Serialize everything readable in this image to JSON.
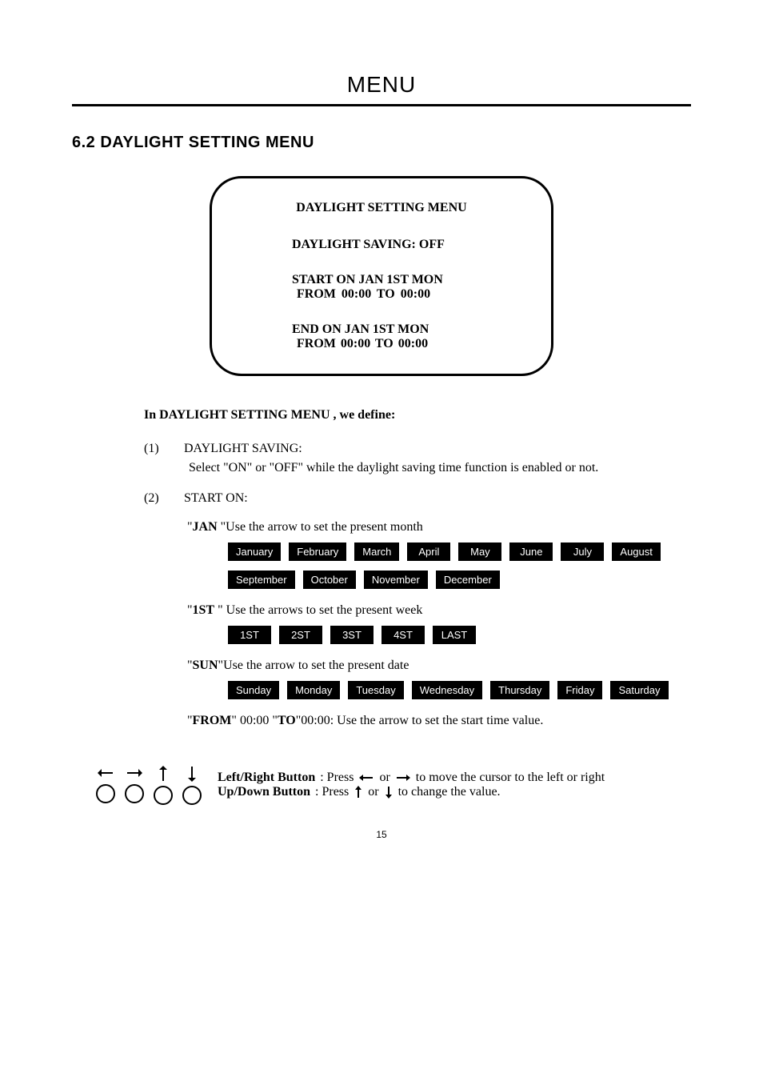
{
  "header": {
    "title": "MENU"
  },
  "section": {
    "heading": "6.2 DAYLIGHT SETTING MENU"
  },
  "screen": {
    "title": "DAYLIGHT  SETTING MENU",
    "saving_line": "DAYLIGHT SAVING: OFF",
    "start_l1": "START  ON   JAN  1ST  MON",
    "start_l2": "FROM   00:00      TO       00:00",
    "end_l1": "END  ON   JAN  1ST  MON",
    "end_l2": "FROM   00:00   TO   00:00"
  },
  "intro": "In DAYLIGHT  SETTING MENU , we define:",
  "items": {
    "one": {
      "idx": "(1)",
      "label": "DAYLIGHT SAVING:",
      "desc": "Select \"ON\" or \"OFF\" while the daylight saving time function is enabled or not."
    },
    "two": {
      "idx": "(2)",
      "label": "START ON:"
    }
  },
  "month_hint_pre": "\"",
  "month_hint_bold": "JAN",
  "month_hint_post": " \"Use the arrow to set the present month",
  "months": [
    "January",
    "February",
    "March",
    "April",
    "May",
    "June",
    "July",
    "August",
    "September",
    "October",
    "November",
    "December"
  ],
  "week_hint_pre": "\"",
  "week_hint_bold": "1ST",
  "week_hint_post": " \" Use the arrows to set the present week",
  "weeks": [
    "1ST",
    "2ST",
    "3ST",
    "4ST",
    "LAST"
  ],
  "day_hint_pre": "\"",
  "day_hint_bold": "SUN",
  "day_hint_post": "\"Use the arrow to set the present date",
  "days": [
    "Sunday",
    "Monday",
    "Tuesday",
    "Wednesday",
    "Thursday",
    "Friday",
    "Saturday"
  ],
  "fromto_hint_pre": "\"",
  "fromto_hint_b1": "FROM",
  "fromto_hint_mid": "\" 00:00 \"",
  "fromto_hint_b2": "TO",
  "fromto_hint_post": "\"00:00: Use the arrow to set the start time value.",
  "footer": {
    "lr_label": "Left/Right Button",
    "lr_text1": ": Press",
    "lr_or": "or",
    "lr_text2": "to move the cursor to the left or right",
    "ud_label": "Up/Down Button",
    "ud_text1": ": Press",
    "ud_or": "or",
    "ud_text2": "to change the value."
  },
  "page_number": "15",
  "glyphs": {
    "left": "◄",
    "right": "►",
    "up": "▲",
    "down": "▼",
    "big_left": "←",
    "big_right": "→",
    "big_up": "↑",
    "big_down": "↓"
  }
}
